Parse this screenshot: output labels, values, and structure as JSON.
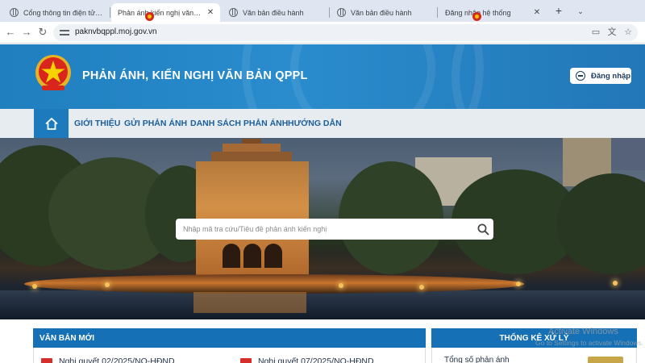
{
  "browser": {
    "tabs": [
      {
        "label": "Cổng thông tin điện tử Bộ T",
        "favicon": "globe-icon",
        "active": false
      },
      {
        "label": "Phản ánh kiến nghị văn bản",
        "favicon": "emblem-icon",
        "active": true
      },
      {
        "label": "Văn bản điều hành",
        "favicon": "globe-icon",
        "active": false
      },
      {
        "label": "Văn bản điều hành",
        "favicon": "globe-icon",
        "active": false
      },
      {
        "label": "Đăng nhập hệ thống",
        "favicon": "emblem-icon",
        "active": false
      }
    ],
    "new_tab_label": "+",
    "tab_menu_label": "⌄",
    "url": "paknvbqppl.moj.gov.vn"
  },
  "header": {
    "title": "PHẢN ÁNH, KIẾN NGHỊ VĂN BẢN QPPL",
    "login_label": "Đăng nhập",
    "brand_color": "#1f7fbf"
  },
  "nav": {
    "home_icon": "home-icon",
    "items": [
      "GIỚI THIỆU",
      "GỬI PHẢN ÁNH",
      "DANH SÁCH PHẢN ÁNH",
      "HƯỚNG DẪN"
    ]
  },
  "search": {
    "placeholder": "Nhập mã tra cứu/Tiêu đề phản ánh kiến nghị",
    "value": ""
  },
  "panels": {
    "new_docs": {
      "title": "VĂN BẢN MỚI",
      "items": [
        "Nghị quyết 02/2025/NQ-HĐND",
        "Nghị quyết 07/2025/NQ-HĐND"
      ]
    },
    "stats": {
      "title": "THỐNG KÊ XỬ LÝ",
      "label": "Tổng số phản ánh"
    }
  },
  "windows_watermark": {
    "line1": "Activate Windows",
    "line2": "Go to Settings to activate Windows."
  }
}
